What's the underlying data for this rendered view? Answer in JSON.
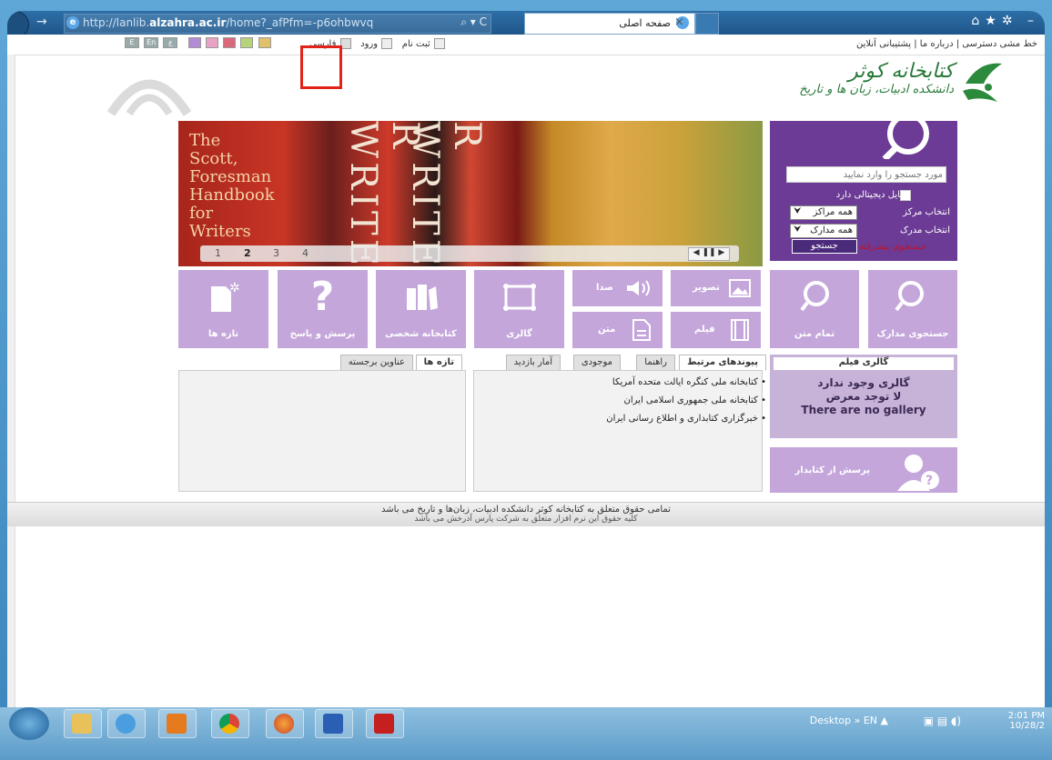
{
  "browser": {
    "url_prefix": "http://lanlib.",
    "url_host": "alzahra.ac.ir",
    "url_suffix": "/home?_afPfm=-p6ohbwvq",
    "addr_controls": "⌕ ▾ C",
    "tab_title": "صفحه اصلی",
    "tab_close": "×",
    "right_icons": "⌂★✲ –"
  },
  "topbar": {
    "right_links": "خط مشی دسترسی | درباره ما | پشتیبانی آنلاین",
    "register": "ثبت نام",
    "login": "ورود",
    "lang_fa": "فارسی",
    "lang_en": "En",
    "lang_ar": "ع",
    "lang_other": "E"
  },
  "logo": {
    "name": "کتابخانه کوثر",
    "subtitle": "دانشکده ادبیات، زبان ها و تاریخ"
  },
  "banner": {
    "book_title": "The Scott, Foresman Handbook for Writers",
    "spine1": "R WRITER",
    "spine2": "R WRITER",
    "pages": [
      "1",
      "2",
      "3",
      "4"
    ],
    "controls": "◀ ❚❚ ▶"
  },
  "search": {
    "placeholder": "مورد جستجو را وارد نمایید",
    "digital_label": "فایل دیجیتالی دارد",
    "center_label": "انتخاب مرکز",
    "center_value": "همه مراکز",
    "doc_label": "انتخاب مدرک",
    "doc_value": "همه مدارک",
    "search_button": "جستجو",
    "advanced": "جستجوی پیشرفته"
  },
  "tiles": {
    "search_docs": "جستجوی مدارک",
    "full_text": "تمام متن",
    "image": "تصویر",
    "audio": "صدا",
    "film": "فیلم",
    "text": "متن",
    "gallery": "گالری",
    "personal_library": "کتابخانه شخصی",
    "qa": "پرسش و پاسخ",
    "news": "تازه ها"
  },
  "tabs_mid": [
    "پیوندهای مرتبط",
    "راهنما",
    "موجودی",
    "آمار بازدید"
  ],
  "tabs_left": [
    "تازه ها",
    "عناوین برجسته"
  ],
  "links": [
    "• کتابخانه ملی کنگره ایالت متحده آمریکا",
    "• کتابخانه ملی جمهوری اسلامی ایران",
    "• خبرگزاری کتابداری و اطلاع رسانی ایران"
  ],
  "gallery": {
    "head": "گالری فیلم",
    "msg1": "گالری وجود ندارد",
    "msg2": "لا توجد معرض",
    "msg3": "There are no gallery"
  },
  "ask": {
    "label": "پرسش از کتابدار"
  },
  "footer": {
    "line1": "تمامی حقوق متعلق به کتابخانه کوثر دانشکده ادبیات، زبان‌ها و تاریخ می باشد",
    "line2": "کلیه حقوق این نرم افزار متعلق به شرکت پارس آذرخش می باشد"
  },
  "taskbar": {
    "tray": "Desktop  »  EN  ▲",
    "time": "2:01 PM",
    "date": "10/28/2"
  },
  "colors": {
    "purple_dark": "#6b3b95",
    "purple_tile": "#c4a6db",
    "highlight": "#e2231a"
  }
}
